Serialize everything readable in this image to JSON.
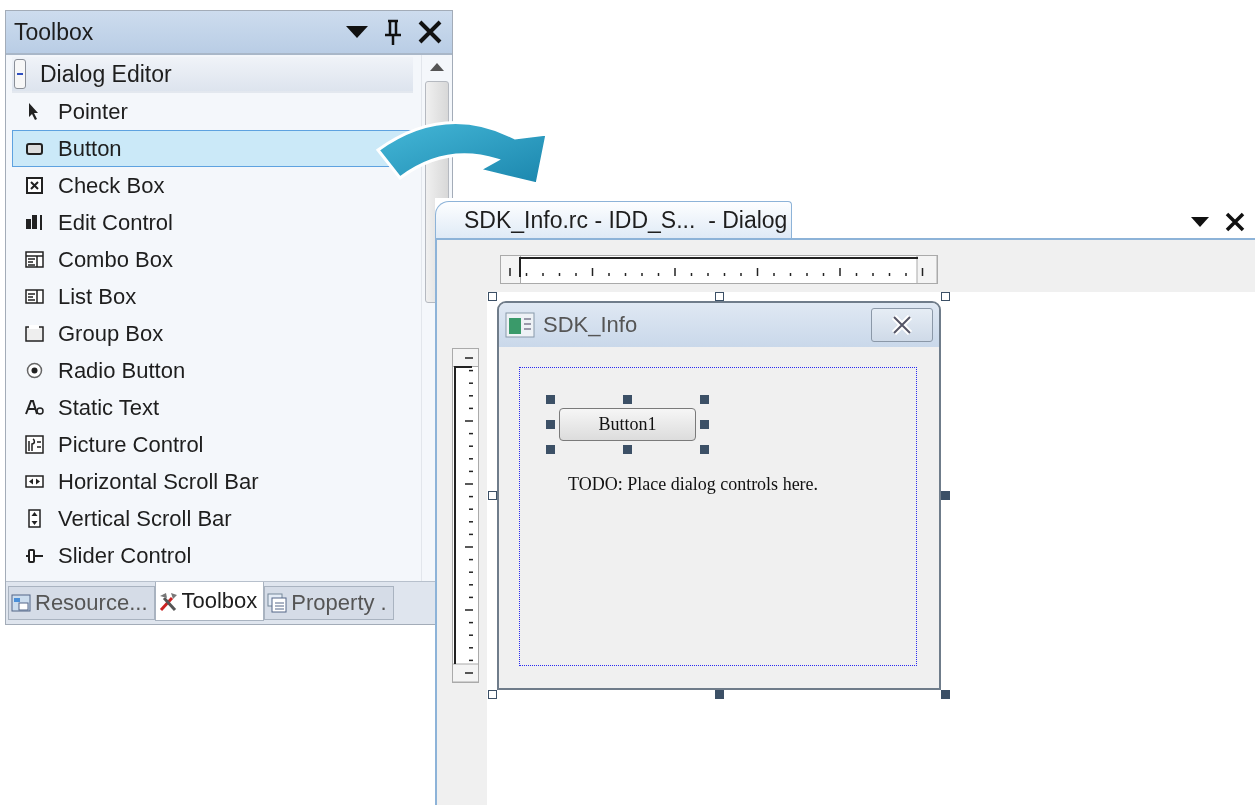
{
  "toolbox": {
    "title": "Toolbox",
    "group": {
      "label": "Dialog Editor",
      "expanded": true
    },
    "items": [
      {
        "label": "Pointer",
        "selected": false
      },
      {
        "label": "Button",
        "selected": true
      },
      {
        "label": "Check Box",
        "selected": false
      },
      {
        "label": "Edit Control",
        "selected": false
      },
      {
        "label": "Combo Box",
        "selected": false
      },
      {
        "label": "List Box",
        "selected": false
      },
      {
        "label": "Group Box",
        "selected": false
      },
      {
        "label": "Radio Button",
        "selected": false
      },
      {
        "label": "Static Text",
        "selected": false
      },
      {
        "label": "Picture Control",
        "selected": false
      },
      {
        "label": "Horizontal Scroll Bar",
        "selected": false
      },
      {
        "label": "Vertical Scroll Bar",
        "selected": false
      },
      {
        "label": "Slider Control",
        "selected": false
      }
    ],
    "tabs": [
      {
        "label": "Resource...",
        "selected": false
      },
      {
        "label": "Toolbox",
        "selected": true
      },
      {
        "label": "Property .",
        "selected": false
      }
    ]
  },
  "editor": {
    "tab": "SDK_Info.rc - IDD_S...  - Dialog",
    "dialog": {
      "title": "SDK_Info",
      "button": {
        "label": "Button1",
        "selected": true
      },
      "static_text": "TODO: Place dialog controls here."
    }
  }
}
